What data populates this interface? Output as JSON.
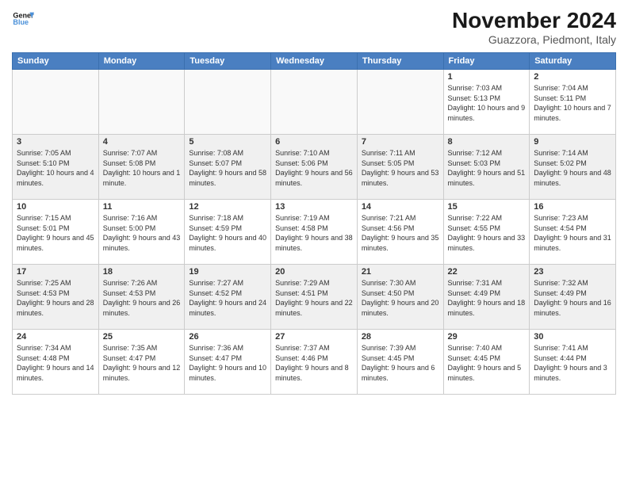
{
  "header": {
    "logo_line1": "General",
    "logo_line2": "Blue",
    "month_title": "November 2024",
    "location": "Guazzora, Piedmont, Italy"
  },
  "days_of_week": [
    "Sunday",
    "Monday",
    "Tuesday",
    "Wednesday",
    "Thursday",
    "Friday",
    "Saturday"
  ],
  "weeks": [
    [
      {
        "day": "",
        "info": ""
      },
      {
        "day": "",
        "info": ""
      },
      {
        "day": "",
        "info": ""
      },
      {
        "day": "",
        "info": ""
      },
      {
        "day": "",
        "info": ""
      },
      {
        "day": "1",
        "info": "Sunrise: 7:03 AM\nSunset: 5:13 PM\nDaylight: 10 hours and 9 minutes."
      },
      {
        "day": "2",
        "info": "Sunrise: 7:04 AM\nSunset: 5:11 PM\nDaylight: 10 hours and 7 minutes."
      }
    ],
    [
      {
        "day": "3",
        "info": "Sunrise: 7:05 AM\nSunset: 5:10 PM\nDaylight: 10 hours and 4 minutes."
      },
      {
        "day": "4",
        "info": "Sunrise: 7:07 AM\nSunset: 5:08 PM\nDaylight: 10 hours and 1 minute."
      },
      {
        "day": "5",
        "info": "Sunrise: 7:08 AM\nSunset: 5:07 PM\nDaylight: 9 hours and 58 minutes."
      },
      {
        "day": "6",
        "info": "Sunrise: 7:10 AM\nSunset: 5:06 PM\nDaylight: 9 hours and 56 minutes."
      },
      {
        "day": "7",
        "info": "Sunrise: 7:11 AM\nSunset: 5:05 PM\nDaylight: 9 hours and 53 minutes."
      },
      {
        "day": "8",
        "info": "Sunrise: 7:12 AM\nSunset: 5:03 PM\nDaylight: 9 hours and 51 minutes."
      },
      {
        "day": "9",
        "info": "Sunrise: 7:14 AM\nSunset: 5:02 PM\nDaylight: 9 hours and 48 minutes."
      }
    ],
    [
      {
        "day": "10",
        "info": "Sunrise: 7:15 AM\nSunset: 5:01 PM\nDaylight: 9 hours and 45 minutes."
      },
      {
        "day": "11",
        "info": "Sunrise: 7:16 AM\nSunset: 5:00 PM\nDaylight: 9 hours and 43 minutes."
      },
      {
        "day": "12",
        "info": "Sunrise: 7:18 AM\nSunset: 4:59 PM\nDaylight: 9 hours and 40 minutes."
      },
      {
        "day": "13",
        "info": "Sunrise: 7:19 AM\nSunset: 4:58 PM\nDaylight: 9 hours and 38 minutes."
      },
      {
        "day": "14",
        "info": "Sunrise: 7:21 AM\nSunset: 4:56 PM\nDaylight: 9 hours and 35 minutes."
      },
      {
        "day": "15",
        "info": "Sunrise: 7:22 AM\nSunset: 4:55 PM\nDaylight: 9 hours and 33 minutes."
      },
      {
        "day": "16",
        "info": "Sunrise: 7:23 AM\nSunset: 4:54 PM\nDaylight: 9 hours and 31 minutes."
      }
    ],
    [
      {
        "day": "17",
        "info": "Sunrise: 7:25 AM\nSunset: 4:53 PM\nDaylight: 9 hours and 28 minutes."
      },
      {
        "day": "18",
        "info": "Sunrise: 7:26 AM\nSunset: 4:53 PM\nDaylight: 9 hours and 26 minutes."
      },
      {
        "day": "19",
        "info": "Sunrise: 7:27 AM\nSunset: 4:52 PM\nDaylight: 9 hours and 24 minutes."
      },
      {
        "day": "20",
        "info": "Sunrise: 7:29 AM\nSunset: 4:51 PM\nDaylight: 9 hours and 22 minutes."
      },
      {
        "day": "21",
        "info": "Sunrise: 7:30 AM\nSunset: 4:50 PM\nDaylight: 9 hours and 20 minutes."
      },
      {
        "day": "22",
        "info": "Sunrise: 7:31 AM\nSunset: 4:49 PM\nDaylight: 9 hours and 18 minutes."
      },
      {
        "day": "23",
        "info": "Sunrise: 7:32 AM\nSunset: 4:49 PM\nDaylight: 9 hours and 16 minutes."
      }
    ],
    [
      {
        "day": "24",
        "info": "Sunrise: 7:34 AM\nSunset: 4:48 PM\nDaylight: 9 hours and 14 minutes."
      },
      {
        "day": "25",
        "info": "Sunrise: 7:35 AM\nSunset: 4:47 PM\nDaylight: 9 hours and 12 minutes."
      },
      {
        "day": "26",
        "info": "Sunrise: 7:36 AM\nSunset: 4:47 PM\nDaylight: 9 hours and 10 minutes."
      },
      {
        "day": "27",
        "info": "Sunrise: 7:37 AM\nSunset: 4:46 PM\nDaylight: 9 hours and 8 minutes."
      },
      {
        "day": "28",
        "info": "Sunrise: 7:39 AM\nSunset: 4:45 PM\nDaylight: 9 hours and 6 minutes."
      },
      {
        "day": "29",
        "info": "Sunrise: 7:40 AM\nSunset: 4:45 PM\nDaylight: 9 hours and 5 minutes."
      },
      {
        "day": "30",
        "info": "Sunrise: 7:41 AM\nSunset: 4:44 PM\nDaylight: 9 hours and 3 minutes."
      }
    ]
  ]
}
